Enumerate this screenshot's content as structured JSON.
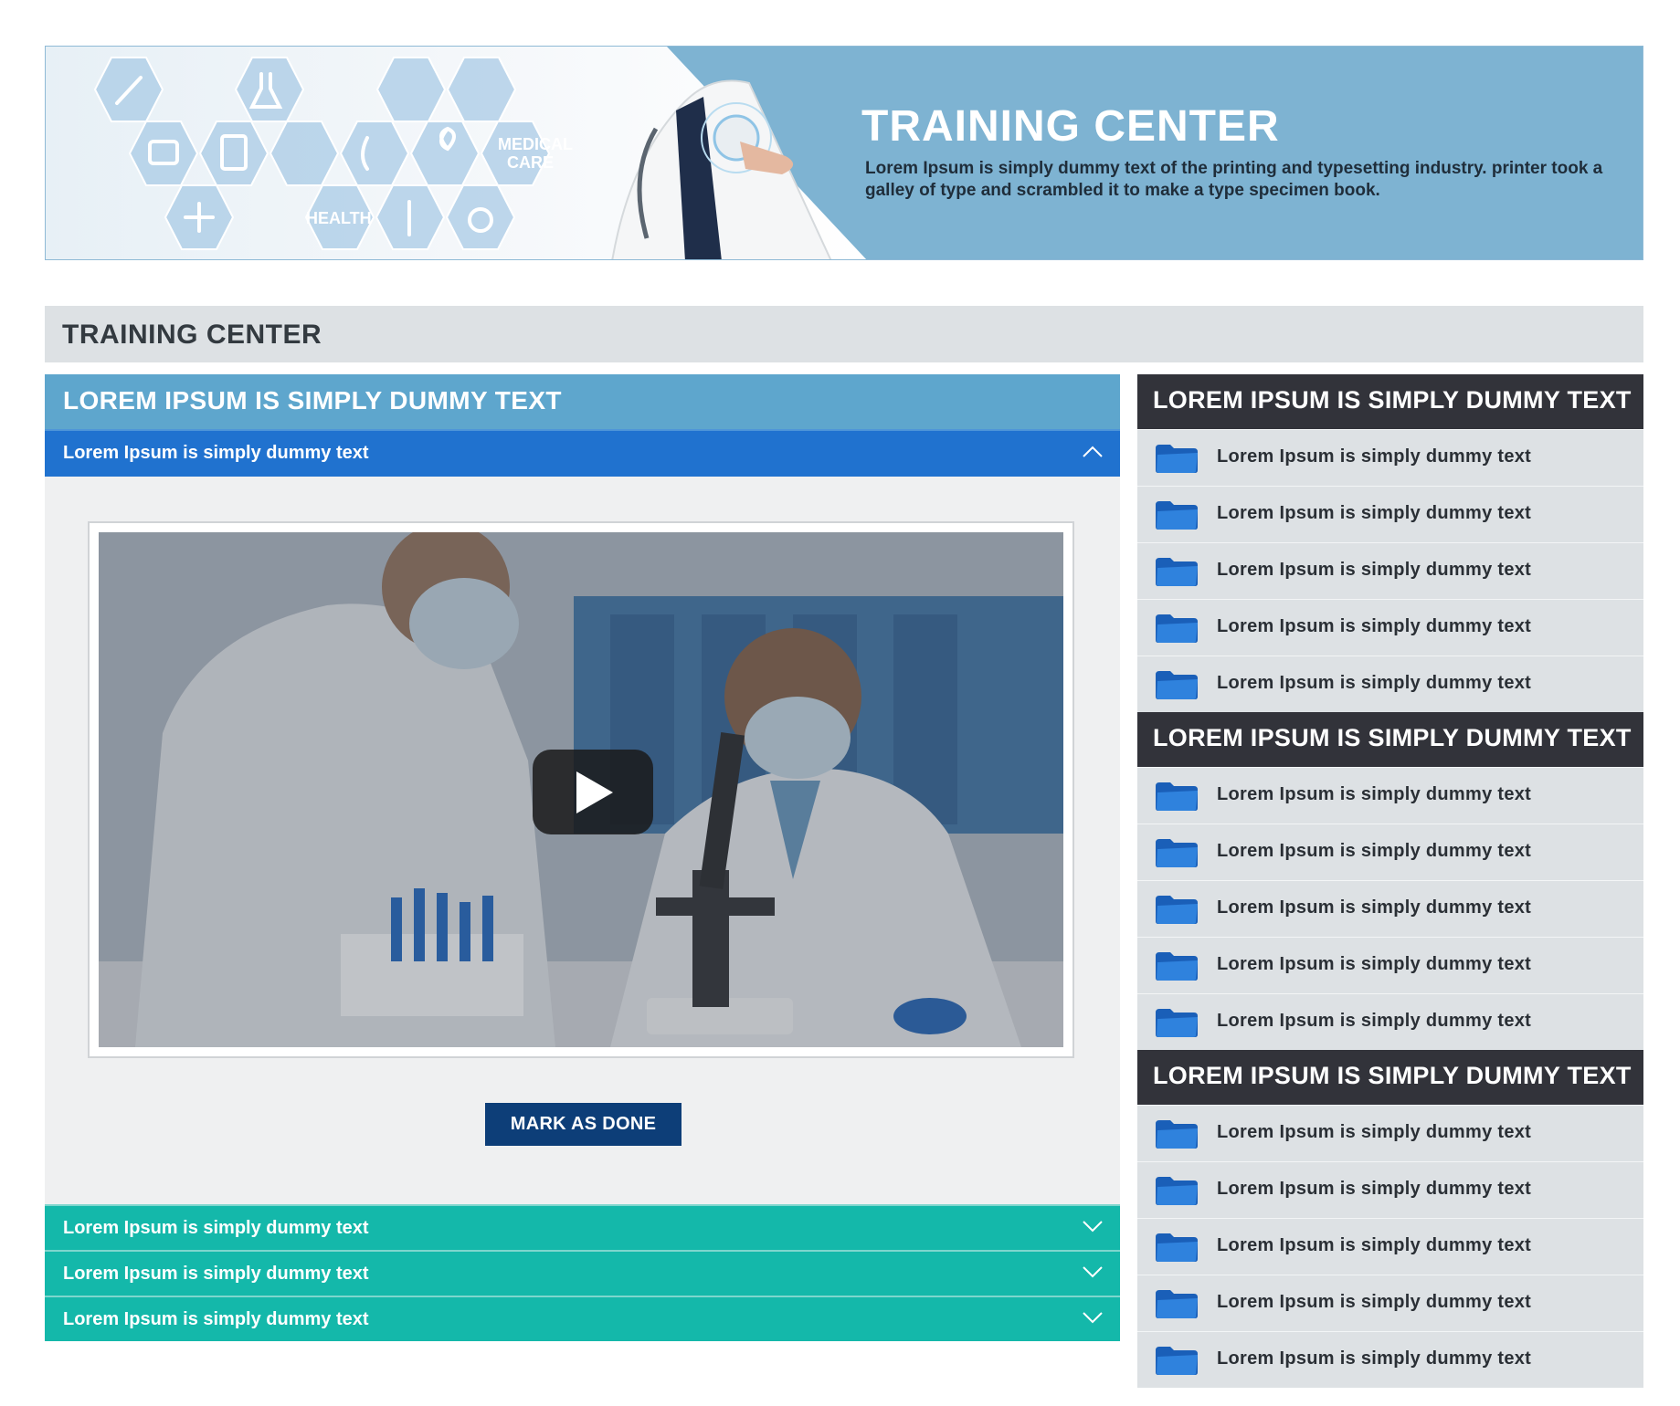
{
  "banner": {
    "title": "TRAINING CENTER",
    "description": "Lorem Ipsum is simply dummy text of the printing and typesetting industry. printer took a galley of type and scrambled it to make a type specimen book.",
    "hex_labels": {
      "medical_care": "MEDICAL CARE",
      "health": "HEALTH"
    }
  },
  "section": {
    "title": "TRAINING CENTER"
  },
  "left": {
    "title": "LOREM IPSUM IS SIMPLY DUMMY TEXT",
    "open_item": "Lorem Ipsum is simply dummy text",
    "mark_done": "MARK AS DONE",
    "closed_items": [
      "Lorem Ipsum is simply dummy text",
      "Lorem Ipsum is simply dummy text",
      "Lorem Ipsum is simply dummy text"
    ]
  },
  "right": {
    "groups": [
      {
        "title": "LOREM IPSUM IS SIMPLY DUMMY TEXT",
        "items": [
          "Lorem Ipsum is simply dummy text",
          "Lorem Ipsum is simply dummy text",
          "Lorem Ipsum is simply dummy text",
          "Lorem Ipsum is simply dummy text",
          "Lorem Ipsum is simply dummy text"
        ]
      },
      {
        "title": "LOREM IPSUM IS SIMPLY DUMMY TEXT",
        "items": [
          "Lorem Ipsum is simply dummy text",
          "Lorem Ipsum is simply dummy text",
          "Lorem Ipsum is simply dummy text",
          "Lorem Ipsum is simply dummy text",
          "Lorem Ipsum is simply dummy text"
        ]
      },
      {
        "title": "LOREM IPSUM IS SIMPLY DUMMY TEXT",
        "items": [
          "Lorem Ipsum is simply dummy text",
          "Lorem Ipsum is simply dummy text",
          "Lorem Ipsum is simply dummy text",
          "Lorem Ipsum is simply dummy text",
          "Lorem Ipsum is simply dummy text"
        ]
      }
    ]
  },
  "icons": {
    "chevron_up": "chevron-up-icon",
    "chevron_down": "chevron-down-icon",
    "folder": "folder-icon",
    "play": "play-icon"
  },
  "colors": {
    "banner_bg": "#7eb3d2",
    "left_title_bg": "#5ea6cd",
    "accordion_open": "#2072cf",
    "accordion_closed": "#14b8aa",
    "right_header": "#32333a",
    "button": "#0d3e78",
    "folder": "#1f6fcf"
  }
}
